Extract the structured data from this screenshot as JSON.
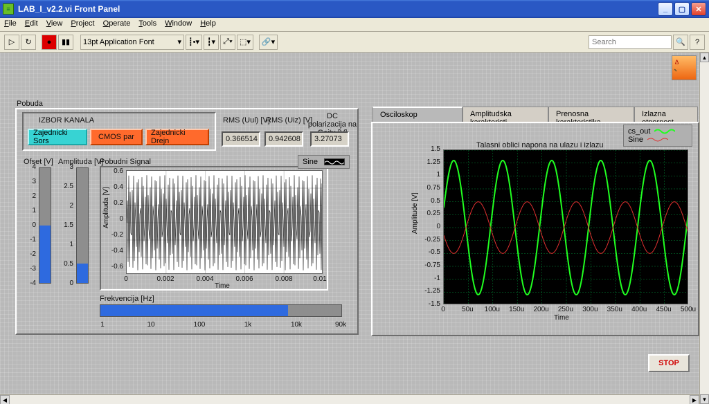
{
  "window": {
    "title": "LAB_I_v2.2.vi Front Panel"
  },
  "menu": {
    "file": "File",
    "edit": "Edit",
    "view": "View",
    "project": "Project",
    "operate": "Operate",
    "tools": "Tools",
    "window": "Window",
    "help": "Help"
  },
  "toolbar": {
    "font": "13pt Application Font",
    "search_ph": "Search"
  },
  "pobuda": {
    "title": "Pobuda",
    "izbor_label": "IZBOR KANALA",
    "btn_zs": "Zajednicki Sors",
    "btn_cmos": "CMOS par",
    "btn_zd": "Zajednicki Drejn",
    "rms_uul_label": "RMS (Uul) [V]",
    "rms_uiz_label": "RMS (Uiz) [V]",
    "dc_label": "DC polarizacija na Gejtu [V]",
    "rms_uul_val": "0.366514",
    "rms_uiz_val": "0.942608",
    "dc_val": "3.27073",
    "ofset_label": "Ofset [V]",
    "amp_label": "Amplituda [V]",
    "pob_label": "Pobudni Signal",
    "sine_label": "Sine",
    "frekv_label": "Frekvencija [Hz]",
    "amp_axis": "Amplituda [V]",
    "time_axis": "Time"
  },
  "sliders": {
    "ofset_ticks": [
      "4",
      "3",
      "2",
      "1",
      "0",
      "-1",
      "-2",
      "-3",
      "-4"
    ],
    "amp_ticks": [
      "3",
      "2.5",
      "2",
      "1.5",
      "1",
      "0.5",
      "0"
    ],
    "freq_ticks": [
      "1",
      "10",
      "100",
      "1k",
      "10k",
      "90k"
    ]
  },
  "graph1": {
    "yticks": [
      "0.6",
      "0.4",
      "0.2",
      "0",
      "-0.2",
      "-0.4",
      "-0.6"
    ],
    "xticks": [
      "0",
      "0.002",
      "0.004",
      "0.006",
      "0.008",
      "0.01"
    ]
  },
  "rightpanel": {
    "tab1": "Osciloskop",
    "tab2": "Amplitudska karakteristi",
    "tab3": "Prenosna karakteristika",
    "tab4": "Izlazna otpornost",
    "legend_cs": "cs_out",
    "legend_sine": "Sine",
    "chart_title": "Talasni oblici napona na ulazu i izlazu",
    "amp_axis": "Amplitude [V]",
    "time_axis": "Time"
  },
  "graph2": {
    "yticks": [
      "1.5",
      "1.25",
      "1",
      "0.75",
      "0.5",
      "0.25",
      "0",
      "-0.25",
      "-0.5",
      "-0.75",
      "-1",
      "-1.25",
      "-1.5"
    ],
    "xticks": [
      "0",
      "50u",
      "100u",
      "150u",
      "200u",
      "250u",
      "300u",
      "350u",
      "400u",
      "450u",
      "500u"
    ]
  },
  "stop": {
    "label": "STOP"
  },
  "chart_data": [
    {
      "type": "line",
      "title": "Pobudni Signal",
      "xlabel": "Time",
      "ylabel": "Amplituda [V]",
      "xlim": [
        0,
        0.01
      ],
      "ylim": [
        -0.6,
        0.6
      ],
      "series": [
        {
          "name": "Sine",
          "note": "high-frequency sine, amplitude ≈0.55, ~120 cycles over 0..0.01 s, too dense to enumerate points"
        }
      ]
    },
    {
      "type": "line",
      "title": "Talasni oblici napona na ulazu i izlazu",
      "xlabel": "Time",
      "ylabel": "Amplitude [V]",
      "xlim": [
        0,
        0.0005
      ],
      "ylim": [
        -1.5,
        1.5
      ],
      "series": [
        {
          "name": "cs_out",
          "color": "#20ff20",
          "x_us": [
            0,
            25,
            50,
            75,
            100,
            125,
            150,
            175,
            200,
            225,
            250,
            275,
            300,
            325,
            350,
            375,
            400,
            425,
            450,
            475,
            500
          ],
          "y": [
            0.35,
            1.3,
            0.6,
            -1.1,
            -1.05,
            0.6,
            1.3,
            0.35,
            -1.3,
            -0.6,
            1.1,
            1.05,
            -0.6,
            -1.3,
            -0.35,
            1.3,
            0.6,
            -1.1,
            -1.05,
            0.6,
            1.3
          ]
        },
        {
          "name": "Sine",
          "color": "#d03030",
          "x_us": [
            0,
            25,
            50,
            75,
            100,
            125,
            150,
            175,
            200,
            225,
            250,
            275,
            300,
            325,
            350,
            375,
            400,
            425,
            450,
            475,
            500
          ],
          "y": [
            -0.15,
            -0.5,
            -0.25,
            0.45,
            0.4,
            -0.25,
            -0.5,
            -0.15,
            0.5,
            0.25,
            -0.45,
            -0.4,
            0.25,
            0.5,
            0.15,
            -0.5,
            -0.25,
            0.45,
            0.4,
            -0.25,
            -0.5
          ]
        }
      ]
    }
  ]
}
